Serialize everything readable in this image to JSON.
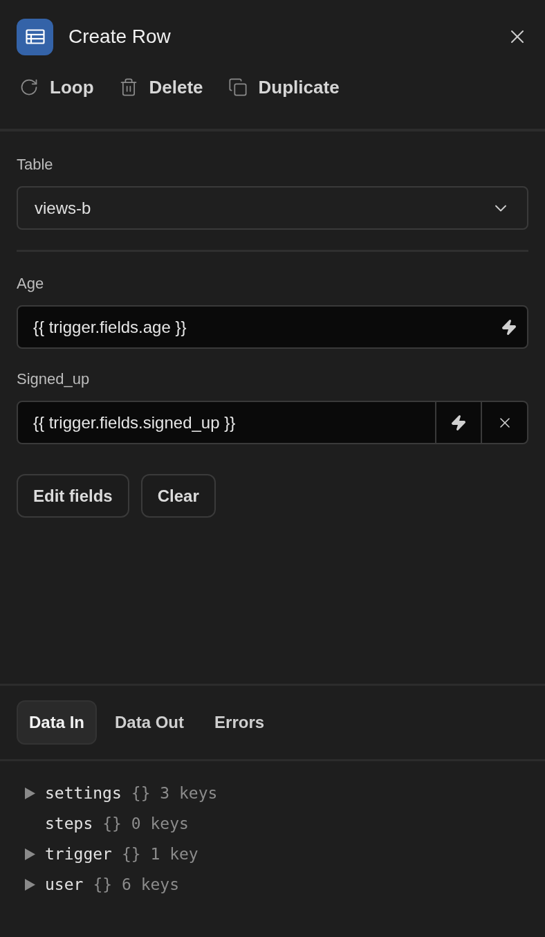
{
  "header": {
    "title": "Create Row"
  },
  "actions": [
    {
      "kind": "loop",
      "label": "Loop"
    },
    {
      "kind": "delete",
      "label": "Delete"
    },
    {
      "kind": "duplicate",
      "label": "Duplicate"
    }
  ],
  "table": {
    "label": "Table",
    "value": "views-b"
  },
  "fields": [
    {
      "label": "Age",
      "value": "{{ trigger.fields.age }}",
      "clearable": false
    },
    {
      "label": "Signed_up",
      "value": "{{ trigger.fields.signed_up }}",
      "clearable": true
    }
  ],
  "buttons": [
    "Edit fields",
    "Clear"
  ],
  "tabs": [
    {
      "label": "Data In",
      "selected": true
    },
    {
      "label": "Data Out",
      "selected": false
    },
    {
      "label": "Errors",
      "selected": false
    }
  ],
  "tree": [
    {
      "name": "settings",
      "summary": "{} 3 keys",
      "expandable": true
    },
    {
      "name": "steps",
      "summary": "{} 0 keys",
      "expandable": false
    },
    {
      "name": "trigger",
      "summary": "{} 1 key",
      "expandable": true
    },
    {
      "name": "user",
      "summary": "{} 6 keys",
      "expandable": true
    }
  ]
}
